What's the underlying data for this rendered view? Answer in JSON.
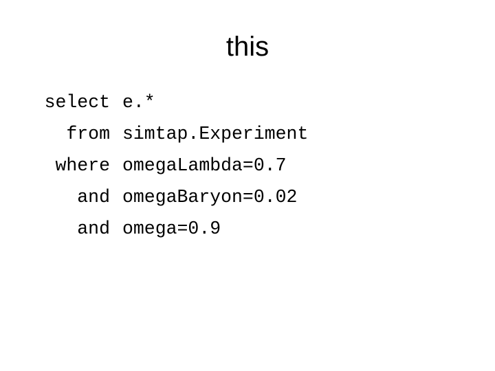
{
  "slide": {
    "title": "this",
    "query": [
      {
        "keyword": "select",
        "clause": "e.*"
      },
      {
        "keyword": "from",
        "clause": "simtap.Experiment"
      },
      {
        "keyword": "where",
        "clause": "omegaLambda=0.7"
      },
      {
        "keyword": "and",
        "clause": "omegaBaryon=0.02"
      },
      {
        "keyword": "and",
        "clause": "omega=0.9"
      }
    ]
  }
}
